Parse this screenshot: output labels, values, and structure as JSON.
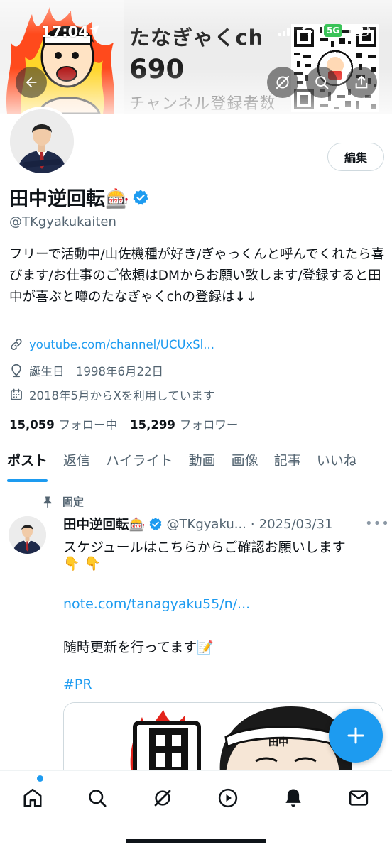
{
  "status_bar": {
    "time": "17:04",
    "network": "5G"
  },
  "banner": {
    "channel_name": "たなぎゃくch",
    "subscriber_count": "690",
    "subscriber_label": "チャンネル登録者数"
  },
  "profile": {
    "edit_label": "編集",
    "display_name": "田中逆回転🎰",
    "handle": "@TKgyakukaiten",
    "bio": "フリーで活動中/山佐機種が好き/ぎゃっくんと呼んでくれたら喜びます/お仕事のご依頼はDMからお願い致します/登録すると田中が喜ぶと噂のたなぎゃくchの登録は↓↓",
    "link": "youtube.com/channel/UCUxSl...",
    "birthday": "誕生日　1998年6月22日",
    "joined": "2018年5月からXを利用しています",
    "following_count": "15,059",
    "following_label": "フォロー中",
    "followers_count": "15,299",
    "followers_label": "フォロワー"
  },
  "tabs": [
    {
      "label": "ポスト",
      "active": true
    },
    {
      "label": "返信",
      "active": false
    },
    {
      "label": "ハイライト",
      "active": false
    },
    {
      "label": "動画",
      "active": false
    },
    {
      "label": "画像",
      "active": false
    },
    {
      "label": "記事",
      "active": false
    },
    {
      "label": "いいね",
      "active": false
    }
  ],
  "pinned_post": {
    "pinned_label": "固定",
    "author_name": "田中逆回転🎰",
    "author_handle": "@TKgyaku...",
    "date": "2025/03/31",
    "line1": "スケジュールはこちらからご確認お願いします",
    "line2": "👇 👇",
    "link": "note.com/tanagyaku55/n/...",
    "line3": "随時更新を行ってます📝",
    "hashtag": "#PR",
    "image_text": "田中"
  },
  "colors": {
    "accent": "#1d9bf0",
    "text": "#0f1419",
    "secondary": "#536471"
  },
  "icons": [
    "back-arrow-icon",
    "grok-icon",
    "search-icon",
    "share-icon",
    "verified-badge-icon",
    "link-icon",
    "location-icon",
    "calendar-icon",
    "pin-icon",
    "more-icon",
    "compose-plus-icon",
    "home-icon",
    "explore-icon",
    "grok-nav-icon",
    "video-icon",
    "notifications-icon",
    "messages-icon"
  ]
}
